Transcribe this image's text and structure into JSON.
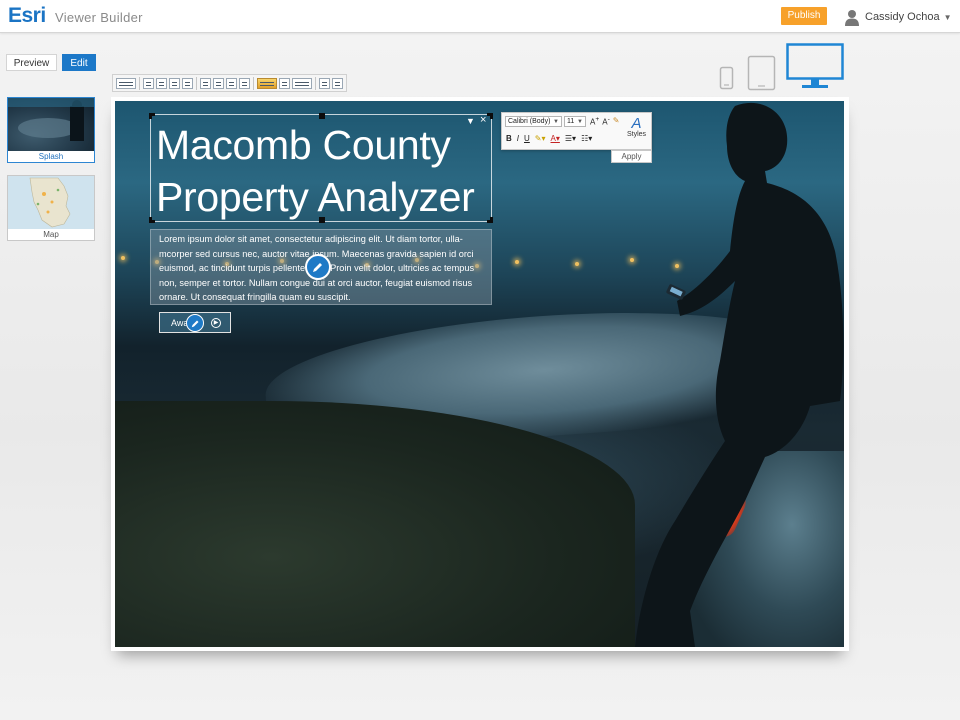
{
  "header": {
    "brand": "Esri",
    "app_name": "Viewer Builder",
    "publish_label": "Publish",
    "user_name": "Cassidy Ochoa"
  },
  "mode": {
    "preview_label": "Preview",
    "edit_label": "Edit",
    "active": "Edit"
  },
  "pages": [
    {
      "label": "Splash",
      "active": true
    },
    {
      "label": "Map",
      "active": false
    }
  ],
  "devices": [
    "phone-icon",
    "tablet-icon",
    "desktop-icon"
  ],
  "active_device": "desktop-icon",
  "splash": {
    "title_line1": "Macomb County",
    "title_line2": "Property Analyzer",
    "body": "Lorem ipsum dolor sit amet, consectetur adipiscing elit. Ut diam tortor, ulla-mcorper sed cursus nec, auctor vitae ipsum. Maecenas gravida sapien id orci euismod, ac tincidunt turpis pellentesque. Proin velit dolor, ultricies ac tempus non, semper et tortor. Nullam congue dui at orci auctor, feugiat euismod risus ornare. Ut consequat fringilla quam eu suscipit.",
    "button_label": "Away"
  },
  "format_popup": {
    "font": "Calibri (Body)",
    "size": "11",
    "styles_label": "Styles",
    "apply_label": "Apply"
  },
  "colors": {
    "brand": "#1b74c4",
    "publish": "#f7a12a",
    "edit_active": "#1c78c8",
    "edit_pin": "#1f7ac6"
  }
}
